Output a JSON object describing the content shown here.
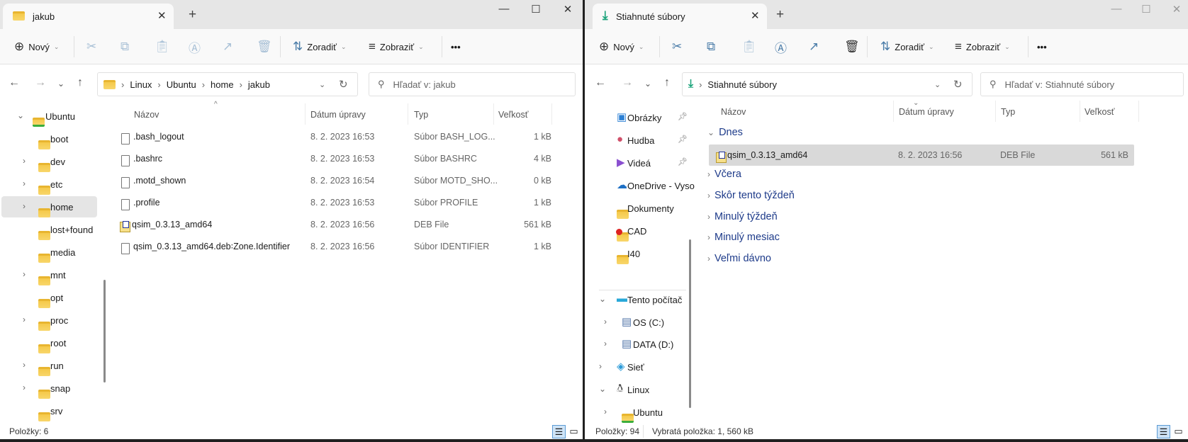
{
  "left": {
    "tab_title": "jakub",
    "toolbar": {
      "new": "Nový",
      "sort": "Zoradiť",
      "view": "Zobraziť",
      "more": "•••"
    },
    "breadcrumb": [
      "Linux",
      "Ubuntu",
      "home",
      "jakub"
    ],
    "search_placeholder": "Hľadať v: jakub",
    "nav": [
      {
        "label": "Ubuntu",
        "chevron": "down",
        "ubuntu": true
      },
      {
        "label": "boot",
        "chevron": ""
      },
      {
        "label": "dev",
        "chevron": "right"
      },
      {
        "label": "etc",
        "chevron": "right"
      },
      {
        "label": "home",
        "chevron": "right",
        "selected": true
      },
      {
        "label": "lost+found",
        "chevron": ""
      },
      {
        "label": "media",
        "chevron": ""
      },
      {
        "label": "mnt",
        "chevron": "right"
      },
      {
        "label": "opt",
        "chevron": ""
      },
      {
        "label": "proc",
        "chevron": "right"
      },
      {
        "label": "root",
        "chevron": ""
      },
      {
        "label": "run",
        "chevron": "right"
      },
      {
        "label": "snap",
        "chevron": "right"
      },
      {
        "label": "srv",
        "chevron": ""
      }
    ],
    "columns": {
      "name": "Názov",
      "date": "Dátum úpravy",
      "type": "Typ",
      "size": "Veľkosť"
    },
    "files": [
      {
        "name": ".bash_logout",
        "date": "8. 2. 2023 16:53",
        "type": "Súbor BASH_LOG...",
        "size": "1 kB",
        "icon": "file"
      },
      {
        "name": ".bashrc",
        "date": "8. 2. 2023 16:53",
        "type": "Súbor BASHRC",
        "size": "4 kB",
        "icon": "file"
      },
      {
        "name": ".motd_shown",
        "date": "8. 2. 2023 16:54",
        "type": "Súbor MOTD_SHO...",
        "size": "0 kB",
        "icon": "file"
      },
      {
        "name": ".profile",
        "date": "8. 2. 2023 16:53",
        "type": "Súbor PROFILE",
        "size": "1 kB",
        "icon": "file"
      },
      {
        "name": "qsim_0.3.13_amd64",
        "date": "8. 2. 2023 16:56",
        "type": "DEB File",
        "size": "561 kB",
        "icon": "deb"
      },
      {
        "name": "qsim_0.3.13_amd64.deb꞉Zone.Identifier",
        "date": "8. 2. 2023 16:56",
        "type": "Súbor IDENTIFIER",
        "size": "1 kB",
        "icon": "file"
      }
    ],
    "status": "Položky: 6"
  },
  "right": {
    "tab_title": "Stiahnuté súbory",
    "toolbar": {
      "new": "Nový",
      "sort": "Zoradiť",
      "view": "Zobraziť",
      "more": "•••"
    },
    "breadcrumb": [
      "Stiahnuté súbory"
    ],
    "search_placeholder": "Hľadať v: Stiahnuté súbory",
    "nav": [
      {
        "label": "Obrázky",
        "icon": "pictures",
        "pinned": true
      },
      {
        "label": "Hudba",
        "icon": "music",
        "pinned": true
      },
      {
        "label": "Videá",
        "icon": "videos",
        "pinned": true
      },
      {
        "label": "OneDrive - Vyso",
        "icon": "onedrive"
      },
      {
        "label": "Dokumenty",
        "icon": "folder"
      },
      {
        "label": "CAD",
        "icon": "folder-warning"
      },
      {
        "label": "I40",
        "icon": "folder"
      },
      {
        "label": "Tento počítač",
        "icon": "computer",
        "chevron": "down"
      },
      {
        "label": "OS (C:)",
        "icon": "drive",
        "chevron": "right",
        "indent": true
      },
      {
        "label": "DATA (D:)",
        "icon": "drive",
        "chevron": "right",
        "indent": true
      },
      {
        "label": "Sieť",
        "icon": "network",
        "chevron": "right"
      },
      {
        "label": "Linux",
        "icon": "linux",
        "chevron": "down"
      },
      {
        "label": "Ubuntu",
        "icon": "folder-ubuntu",
        "chevron": "right",
        "indent": true
      }
    ],
    "columns": {
      "name": "Názov",
      "date": "Dátum úpravy",
      "type": "Typ",
      "size": "Veľkosť"
    },
    "groups": [
      {
        "label": "Dnes",
        "expanded": true
      },
      {
        "label": "Včera"
      },
      {
        "label": "Skôr tento týždeň"
      },
      {
        "label": "Minulý týždeň"
      },
      {
        "label": "Minulý mesiac"
      },
      {
        "label": "Veľmi dávno"
      }
    ],
    "selected_file": {
      "name": "qsim_0.3.13_amd64",
      "date": "8. 2. 2023 16:56",
      "type": "DEB File",
      "size": "561 kB"
    },
    "status_count": "Položky: 94",
    "status_selected": "Vybratá položka: 1, 560 kB"
  },
  "colors": {
    "accent": "#0067c0",
    "selection": "#d9d9d9",
    "group_heading": "#1e3b8a",
    "download_icon": "#1aa37a"
  }
}
